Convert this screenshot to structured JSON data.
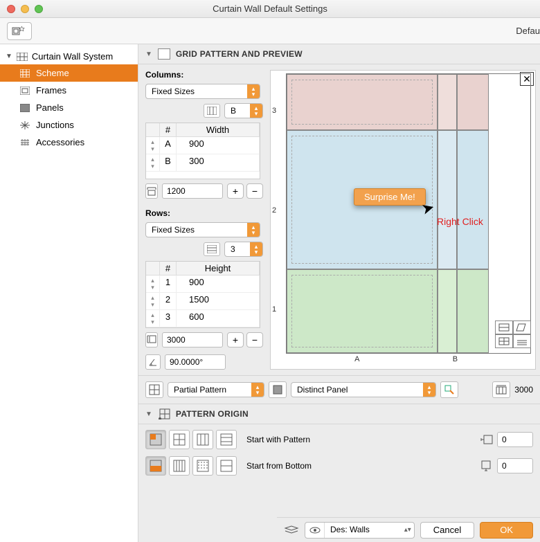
{
  "window": {
    "title": "Curtain Wall Default Settings",
    "default_label": "Defau"
  },
  "sidebar": {
    "root": "Curtain Wall System",
    "items": [
      {
        "label": "Scheme"
      },
      {
        "label": "Frames"
      },
      {
        "label": "Panels"
      },
      {
        "label": "Junctions"
      },
      {
        "label": "Accessories"
      }
    ]
  },
  "grid_section": {
    "title": "GRID PATTERN AND PREVIEW",
    "columns_label": "Columns:",
    "columns_mode": "Fixed Sizes",
    "columns_select": "B",
    "columns_table": {
      "head_idx": "#",
      "head_val": "Width",
      "rows": [
        {
          "idx": "A",
          "val": "900"
        },
        {
          "idx": "B",
          "val": "300"
        }
      ]
    },
    "columns_total": "1200",
    "rows_label": "Rows:",
    "rows_mode": "Fixed Sizes",
    "rows_select": "3",
    "rows_table": {
      "head_idx": "#",
      "head_val": "Height",
      "rows": [
        {
          "idx": "1",
          "val": "900"
        },
        {
          "idx": "2",
          "val": "1500"
        },
        {
          "idx": "3",
          "val": "600"
        }
      ]
    },
    "rows_total": "3000",
    "angle": "90.0000°",
    "pattern_mode": "Partial Pattern",
    "panel_mode": "Distinct Panel",
    "length": "3000",
    "context_menu": "Surprise Me!",
    "right_click": "Right Click",
    "axis_x": [
      "A",
      "B"
    ],
    "axis_y": [
      "1",
      "2",
      "3"
    ]
  },
  "origin_section": {
    "title": "PATTERN ORIGIN",
    "labels": [
      "Start with Pattern",
      "Start from Bottom"
    ],
    "offsets": [
      "0",
      "0"
    ]
  },
  "footer": {
    "layer": "Des: Walls",
    "cancel": "Cancel",
    "ok": "OK"
  },
  "chart_data": {
    "type": "table",
    "columns": {
      "labels": [
        "A",
        "B"
      ],
      "widths": [
        900,
        300
      ]
    },
    "rows": {
      "labels": [
        "1",
        "2",
        "3"
      ],
      "heights": [
        900,
        1500,
        600
      ]
    },
    "total_width": 1200,
    "total_height": 3000,
    "title": "Grid Pattern and Preview"
  }
}
